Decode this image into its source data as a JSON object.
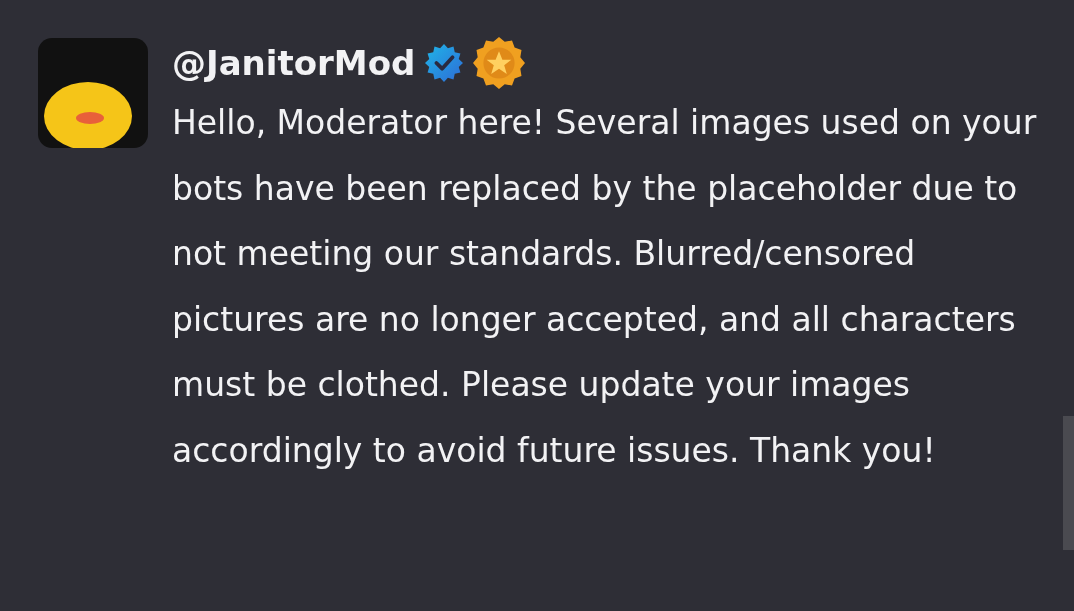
{
  "message": {
    "author": "@JanitorMod",
    "verified": true,
    "badge": true,
    "text": "Hello, Moderator here! Several images used on your bots have been replaced by the placeholder due to not meeting our standards. Blurred/censored pictures are no longer accepted, and all characters must be clothed. Please update your images accordingly to avoid future issues. Thank you!"
  }
}
